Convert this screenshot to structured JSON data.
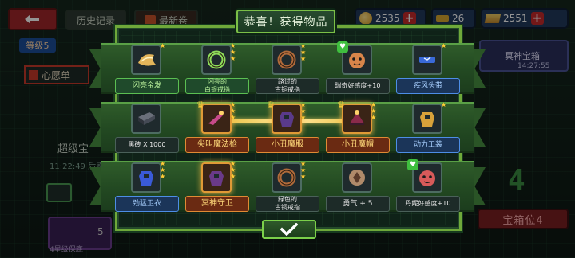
{
  "background": {
    "history_label": "历史记录",
    "latest_label": "最新卷",
    "resources": {
      "gold": "2535",
      "keys": "26",
      "gems": "2551"
    },
    "level": "等级5",
    "wishlist": "心愿单",
    "super_text": "超级宝",
    "timer": "11:22:49 后刷新",
    "key_count": "5",
    "bottom_label": "4星级保底",
    "chest_title": "冥神宝箱",
    "chest_time": "14:27:55",
    "big_digit": "4",
    "chest_slot": "宝箱位4"
  },
  "popup": {
    "title": "恭喜！获得物品",
    "rows": [
      [
        {
          "label": "闪亮金发",
          "rarity": "green",
          "stars": 1,
          "icon": "golden-hair-icon",
          "color": "#e3b45a"
        },
        {
          "label": "闪亮的\n白银戒指",
          "rarity": "green",
          "stars": 3,
          "icon": "silver-ring-icon",
          "color": "#8fdc5a"
        },
        {
          "label": "路过的\n古铜戒指",
          "rarity": "white",
          "stars": 3,
          "icon": "bronze-ring-icon",
          "color": "#b06a3a"
        },
        {
          "label": "瑞奇好感度+10",
          "rarity": "white",
          "stars": 0,
          "icon": "ricky-affinity-icon",
          "color": "#d8854a",
          "badge": "heart"
        },
        {
          "label": "疾风头带",
          "rarity": "blue",
          "stars": 1,
          "icon": "wind-headband-icon",
          "color": "#3a6ad8"
        }
      ],
      [
        {
          "label": "黑砖 X 1000",
          "rarity": "white",
          "stars": 0,
          "icon": "black-brick-icon",
          "color": "#454a55"
        },
        {
          "label": "尖叫魔法枪",
          "rarity": "gold",
          "stars": 3,
          "icon": "screaming-gun-icon",
          "color": "#c84a8a",
          "badge": "hat"
        },
        {
          "label": "小丑魔服",
          "rarity": "gold",
          "stars": 3,
          "icon": "clown-suit-icon",
          "color": "#5a3a8a",
          "badge": "hat"
        },
        {
          "label": "小丑魔帽",
          "rarity": "gold",
          "stars": 3,
          "icon": "clown-hat-icon",
          "color": "#8a2a4a",
          "badge": "hat"
        },
        {
          "label": "动力工装",
          "rarity": "blue",
          "stars": 1,
          "icon": "power-suit-icon",
          "color": "#d8a23a"
        }
      ],
      [
        {
          "label": "劲猛卫衣",
          "rarity": "blue",
          "stars": 3,
          "icon": "hoodie-icon",
          "color": "#3a5ad8"
        },
        {
          "label": "冥神守卫",
          "rarity": "gold",
          "stars": 3,
          "icon": "underworld-guard-icon",
          "color": "#6a3a8a"
        },
        {
          "label": "绿色的\n古铜戒指",
          "rarity": "white",
          "stars": 3,
          "icon": "green-bronze-ring-icon",
          "color": "#b06a3a"
        },
        {
          "label": "勇气 + 5",
          "rarity": "white",
          "stars": 0,
          "icon": "courage-icon",
          "color": "#b08a6a"
        },
        {
          "label": "丹妮好感度+10",
          "rarity": "white",
          "stars": 0,
          "icon": "danni-affinity-icon",
          "color": "#d85a5a",
          "badge": "heart"
        }
      ]
    ]
  },
  "confirm_icon": "checkmark-icon"
}
